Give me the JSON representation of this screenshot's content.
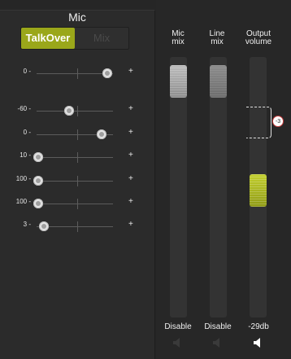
{
  "mic": {
    "title": "Mic",
    "modes": {
      "active_label": "TalkOver",
      "inactive_label": "Mix"
    },
    "sliders": [
      {
        "label": "0 -",
        "plus": "+",
        "level": 0.93
      },
      {
        "label": "-60 -",
        "plus": "+",
        "level": 0.43
      },
      {
        "label": "0 -",
        "plus": "+",
        "level": 0.85
      },
      {
        "label": "10 -",
        "plus": "+",
        "level": 0.02
      },
      {
        "label": "100 -",
        "plus": "+",
        "level": 0.02
      },
      {
        "label": "100 -",
        "plus": "+",
        "level": 0.02
      },
      {
        "label": "3 -",
        "plus": "+",
        "level": 0.1
      }
    ]
  },
  "faders": [
    {
      "label_line1": "Mic",
      "label_line2": "mix",
      "bottom_label": "Disable",
      "speaker_icon": "speaker-icon-disabled",
      "level": 1.0
    },
    {
      "label_line1": "Line",
      "label_line2": "mix",
      "bottom_label": "Disable",
      "speaker_icon": "speaker-icon-disabled",
      "level": 1.0
    },
    {
      "label_line1": "Output",
      "label_line2": "volume",
      "bottom_label": "-29db",
      "speaker_icon": "speaker-icon",
      "level": 0.52
    }
  ],
  "output_marker": {
    "value": "-3"
  },
  "colors": {
    "accent_lime": "#9aa71a",
    "marker_ring": "#c23b3b",
    "background": "#262626"
  }
}
